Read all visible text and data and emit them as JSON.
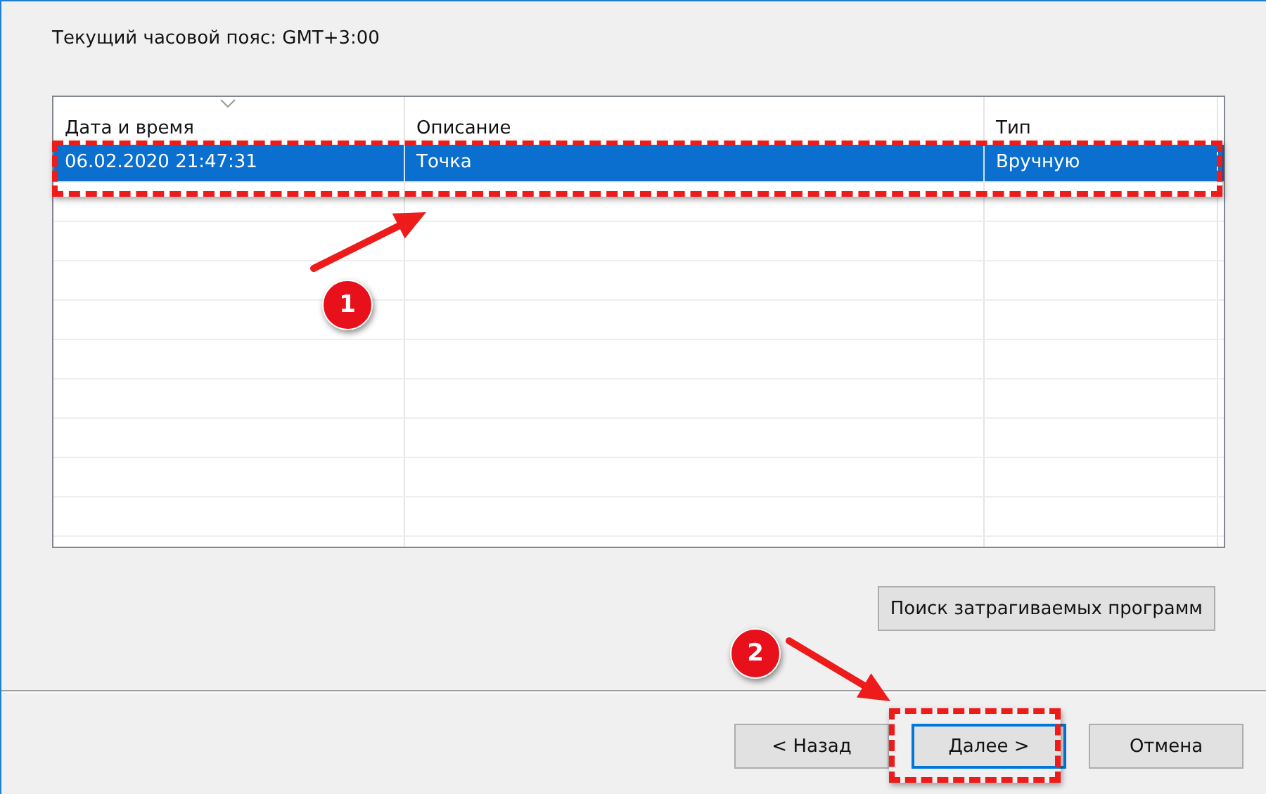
{
  "timezone_label": "Текущий часовой пояс: GMT+3:00",
  "table": {
    "columns": [
      {
        "label": "Дата и время",
        "sorted": true
      },
      {
        "label": "Описание",
        "sorted": false
      },
      {
        "label": "Тип",
        "sorted": false
      }
    ],
    "rows": [
      {
        "cells": [
          "06.02.2020 21:47:31",
          "Точка",
          "Вручную"
        ],
        "selected": true
      }
    ]
  },
  "search_button": "Поиск затрагиваемых программ",
  "buttons": [
    {
      "label": "< Назад",
      "default": false
    },
    {
      "label": "Далее >",
      "default": true
    },
    {
      "label": "Отмена",
      "default": false
    }
  ],
  "callouts": [
    {
      "label": "1",
      "kind": "row"
    },
    {
      "label": "2",
      "kind": "button"
    }
  ]
}
